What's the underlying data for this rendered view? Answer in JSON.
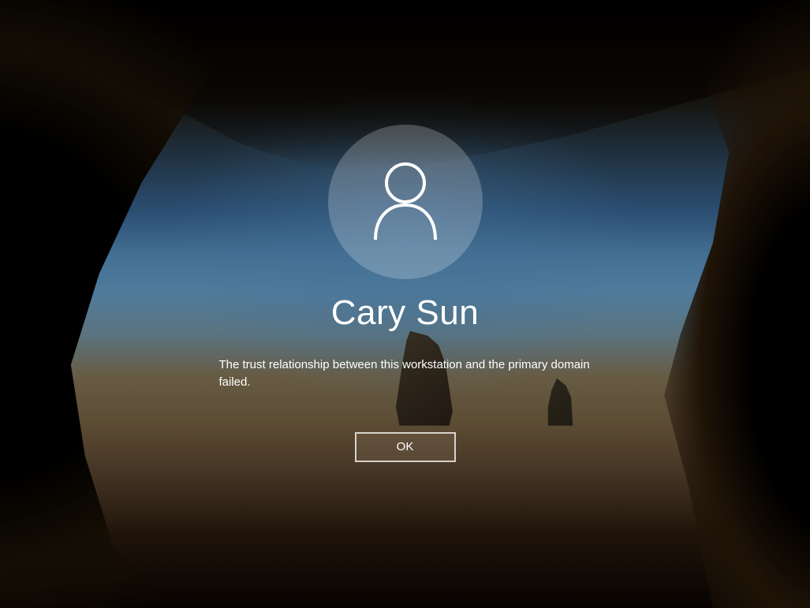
{
  "login": {
    "user_name": "Cary Sun",
    "error_message": "The trust relationship between this workstation and the primary domain failed.",
    "ok_button_label": "OK",
    "avatar_icon": "user-icon"
  }
}
